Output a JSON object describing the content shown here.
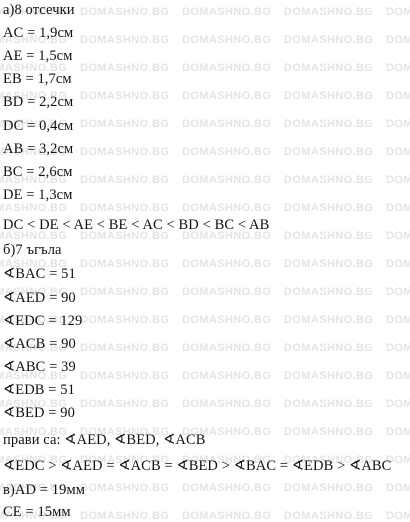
{
  "watermark": {
    "text": "DOMASHNO.BG",
    "color": "#e4e4e4"
  },
  "text_color": "#111111",
  "lines": [
    "а)8 отсечки",
    "AC = 1,9см",
    "AE = 1,5см",
    "EB = 1,7см",
    "BD = 2,2см",
    "DC = 0,4см",
    "AB = 3,2см",
    "BC = 2,6см",
    "DE = 1,3см",
    "DC < DE < AE < BE < AC < BD < BC < AB",
    "б)7 ъгъла",
    "∢BAC = 51",
    "∢AED = 90",
    "∢EDC = 129",
    "∢ACB = 90",
    "∢ABC = 39",
    "∢EDB = 51",
    "∢BED = 90",
    "прави са: ∢AED, ∢BED, ∢ACB",
    "∢EDC > ∢AED = ∢ACB = ∢BED > ∢BAC = ∢EDB > ∢ABC",
    "в)AD = 19мм",
    "CE = 15мм"
  ]
}
